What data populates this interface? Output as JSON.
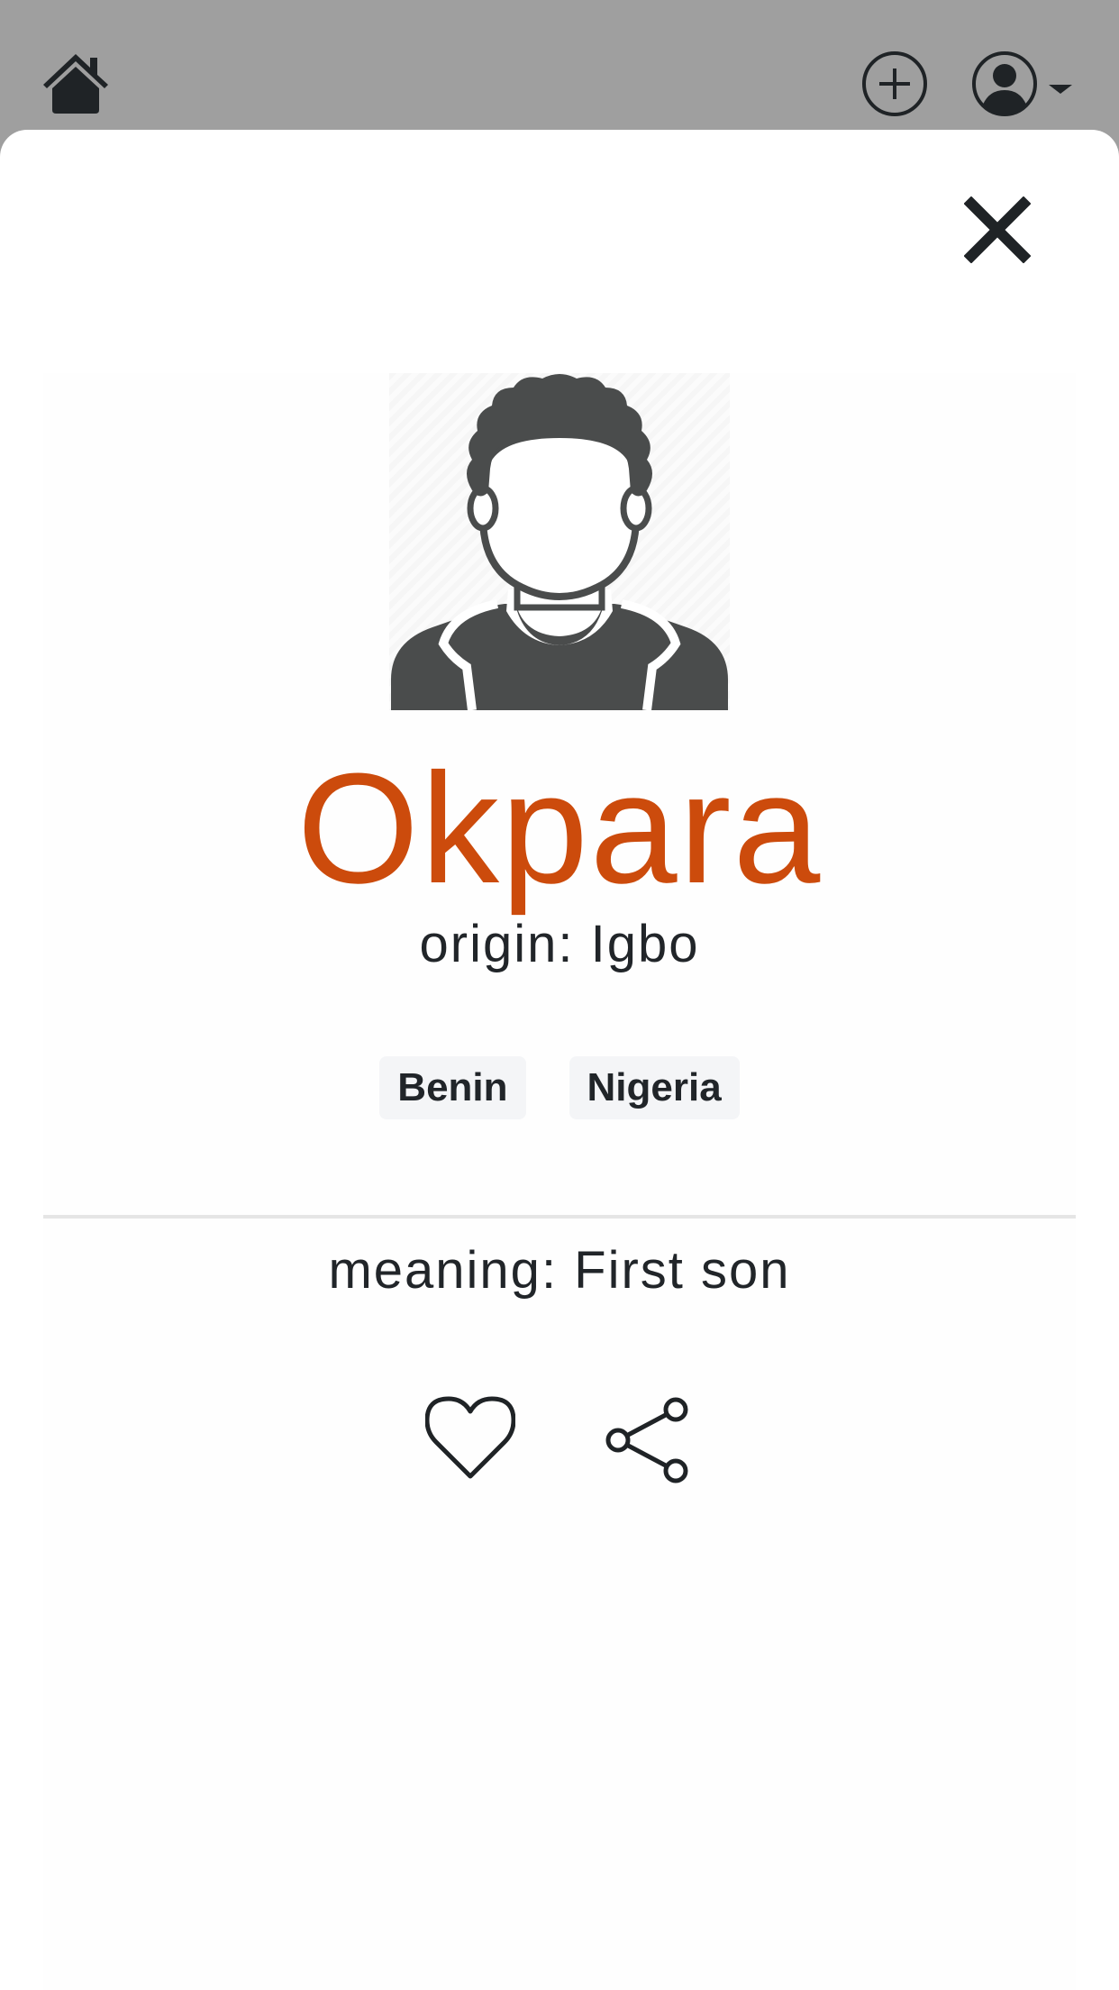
{
  "header": {
    "home_icon": "home-icon",
    "add_icon": "plus-circle-icon",
    "user_icon": "user-circle-icon",
    "dropdown_icon": "caret-down-icon"
  },
  "modal": {
    "close_icon": "close-icon"
  },
  "name_card": {
    "avatar_icon": "person-avatar-icon",
    "name": "Okpara",
    "origin": "origin: Igbo",
    "tags": [
      "Benin",
      "Nigeria"
    ],
    "meaning": "meaning: First son",
    "like_icon": "heart-icon",
    "share_icon": "share-icon"
  },
  "colors": {
    "topbar": "#9f9f9f",
    "name_accent": "#cc4b0c",
    "text": "#212529",
    "tag_background": "#f4f5f7",
    "avatar_fill": "#4a4c4c"
  }
}
